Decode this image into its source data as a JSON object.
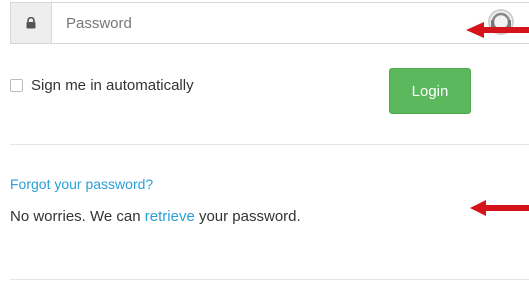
{
  "login_form": {
    "password_placeholder": "Password",
    "remember_label": "Sign me in automatically",
    "login_label": "Login"
  },
  "recovery": {
    "forgot_link": "Forgot your password?",
    "help_prefix": "No worries.  We can ",
    "retrieve_link": "retrieve",
    "help_suffix": " your password."
  },
  "icons": {
    "lock": "lock-icon",
    "reveal": "password-reveal-icon",
    "annotation_arrows": "arrow-left-icon"
  },
  "colors": {
    "accent_link": "#2a9fd6",
    "login_button": "#5cb85c",
    "annotation_arrow": "#d4141a"
  }
}
